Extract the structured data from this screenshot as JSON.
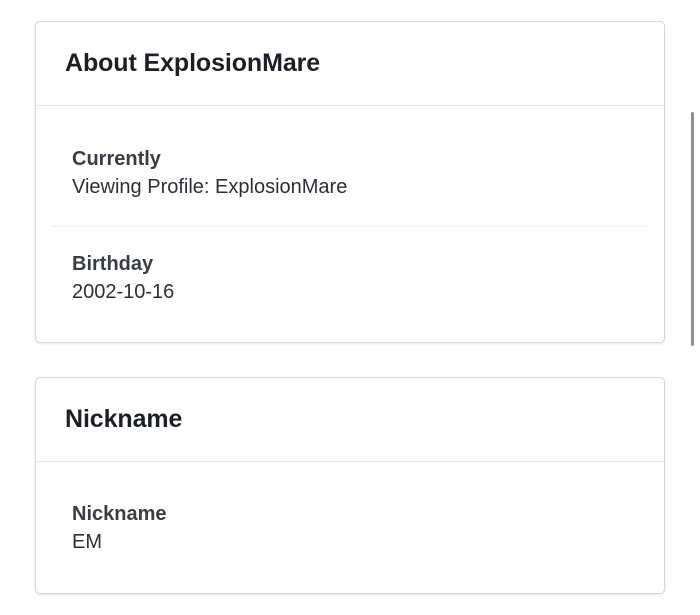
{
  "about_card": {
    "title": "About ExplosionMare",
    "fields": [
      {
        "label": "Currently",
        "value": "Viewing Profile: ExplosionMare"
      },
      {
        "label": "Birthday",
        "value": "2002-10-16"
      }
    ]
  },
  "nickname_card": {
    "title": "Nickname",
    "fields": [
      {
        "label": "Nickname",
        "value": "EM"
      }
    ]
  }
}
